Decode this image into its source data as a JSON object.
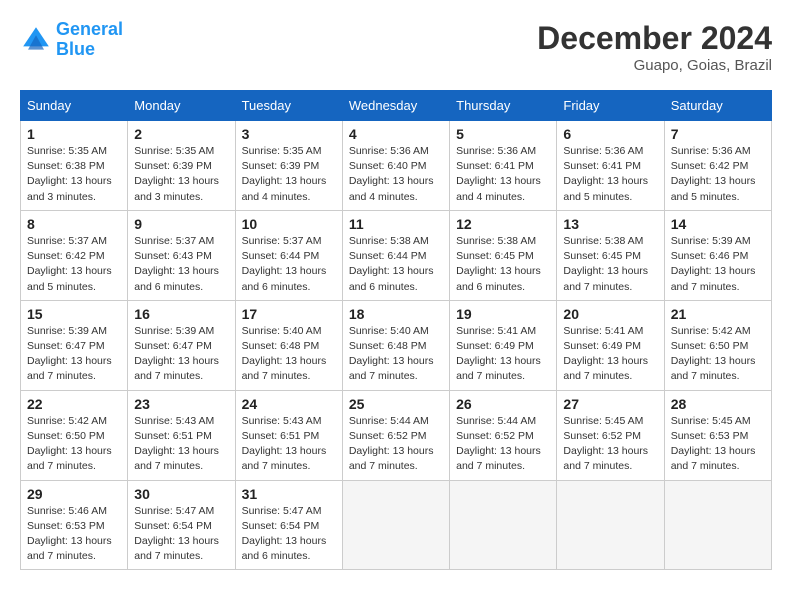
{
  "header": {
    "logo_line1": "General",
    "logo_line2": "Blue",
    "month": "December 2024",
    "location": "Guapo, Goias, Brazil"
  },
  "weekdays": [
    "Sunday",
    "Monday",
    "Tuesday",
    "Wednesday",
    "Thursday",
    "Friday",
    "Saturday"
  ],
  "weeks": [
    [
      {
        "day": "1",
        "info": "Sunrise: 5:35 AM\nSunset: 6:38 PM\nDaylight: 13 hours\nand 3 minutes."
      },
      {
        "day": "2",
        "info": "Sunrise: 5:35 AM\nSunset: 6:39 PM\nDaylight: 13 hours\nand 3 minutes."
      },
      {
        "day": "3",
        "info": "Sunrise: 5:35 AM\nSunset: 6:39 PM\nDaylight: 13 hours\nand 4 minutes."
      },
      {
        "day": "4",
        "info": "Sunrise: 5:36 AM\nSunset: 6:40 PM\nDaylight: 13 hours\nand 4 minutes."
      },
      {
        "day": "5",
        "info": "Sunrise: 5:36 AM\nSunset: 6:41 PM\nDaylight: 13 hours\nand 4 minutes."
      },
      {
        "day": "6",
        "info": "Sunrise: 5:36 AM\nSunset: 6:41 PM\nDaylight: 13 hours\nand 5 minutes."
      },
      {
        "day": "7",
        "info": "Sunrise: 5:36 AM\nSunset: 6:42 PM\nDaylight: 13 hours\nand 5 minutes."
      }
    ],
    [
      {
        "day": "8",
        "info": "Sunrise: 5:37 AM\nSunset: 6:42 PM\nDaylight: 13 hours\nand 5 minutes."
      },
      {
        "day": "9",
        "info": "Sunrise: 5:37 AM\nSunset: 6:43 PM\nDaylight: 13 hours\nand 6 minutes."
      },
      {
        "day": "10",
        "info": "Sunrise: 5:37 AM\nSunset: 6:44 PM\nDaylight: 13 hours\nand 6 minutes."
      },
      {
        "day": "11",
        "info": "Sunrise: 5:38 AM\nSunset: 6:44 PM\nDaylight: 13 hours\nand 6 minutes."
      },
      {
        "day": "12",
        "info": "Sunrise: 5:38 AM\nSunset: 6:45 PM\nDaylight: 13 hours\nand 6 minutes."
      },
      {
        "day": "13",
        "info": "Sunrise: 5:38 AM\nSunset: 6:45 PM\nDaylight: 13 hours\nand 7 minutes."
      },
      {
        "day": "14",
        "info": "Sunrise: 5:39 AM\nSunset: 6:46 PM\nDaylight: 13 hours\nand 7 minutes."
      }
    ],
    [
      {
        "day": "15",
        "info": "Sunrise: 5:39 AM\nSunset: 6:47 PM\nDaylight: 13 hours\nand 7 minutes."
      },
      {
        "day": "16",
        "info": "Sunrise: 5:39 AM\nSunset: 6:47 PM\nDaylight: 13 hours\nand 7 minutes."
      },
      {
        "day": "17",
        "info": "Sunrise: 5:40 AM\nSunset: 6:48 PM\nDaylight: 13 hours\nand 7 minutes."
      },
      {
        "day": "18",
        "info": "Sunrise: 5:40 AM\nSunset: 6:48 PM\nDaylight: 13 hours\nand 7 minutes."
      },
      {
        "day": "19",
        "info": "Sunrise: 5:41 AM\nSunset: 6:49 PM\nDaylight: 13 hours\nand 7 minutes."
      },
      {
        "day": "20",
        "info": "Sunrise: 5:41 AM\nSunset: 6:49 PM\nDaylight: 13 hours\nand 7 minutes."
      },
      {
        "day": "21",
        "info": "Sunrise: 5:42 AM\nSunset: 6:50 PM\nDaylight: 13 hours\nand 7 minutes."
      }
    ],
    [
      {
        "day": "22",
        "info": "Sunrise: 5:42 AM\nSunset: 6:50 PM\nDaylight: 13 hours\nand 7 minutes."
      },
      {
        "day": "23",
        "info": "Sunrise: 5:43 AM\nSunset: 6:51 PM\nDaylight: 13 hours\nand 7 minutes."
      },
      {
        "day": "24",
        "info": "Sunrise: 5:43 AM\nSunset: 6:51 PM\nDaylight: 13 hours\nand 7 minutes."
      },
      {
        "day": "25",
        "info": "Sunrise: 5:44 AM\nSunset: 6:52 PM\nDaylight: 13 hours\nand 7 minutes."
      },
      {
        "day": "26",
        "info": "Sunrise: 5:44 AM\nSunset: 6:52 PM\nDaylight: 13 hours\nand 7 minutes."
      },
      {
        "day": "27",
        "info": "Sunrise: 5:45 AM\nSunset: 6:52 PM\nDaylight: 13 hours\nand 7 minutes."
      },
      {
        "day": "28",
        "info": "Sunrise: 5:45 AM\nSunset: 6:53 PM\nDaylight: 13 hours\nand 7 minutes."
      }
    ],
    [
      {
        "day": "29",
        "info": "Sunrise: 5:46 AM\nSunset: 6:53 PM\nDaylight: 13 hours\nand 7 minutes."
      },
      {
        "day": "30",
        "info": "Sunrise: 5:47 AM\nSunset: 6:54 PM\nDaylight: 13 hours\nand 7 minutes."
      },
      {
        "day": "31",
        "info": "Sunrise: 5:47 AM\nSunset: 6:54 PM\nDaylight: 13 hours\nand 6 minutes."
      },
      {
        "day": "",
        "info": ""
      },
      {
        "day": "",
        "info": ""
      },
      {
        "day": "",
        "info": ""
      },
      {
        "day": "",
        "info": ""
      }
    ]
  ]
}
